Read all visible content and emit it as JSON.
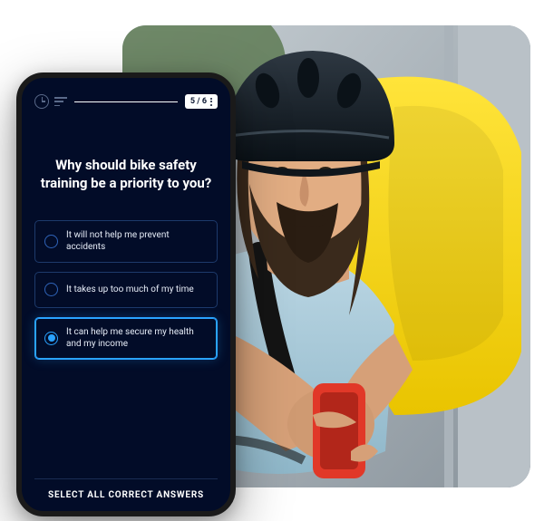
{
  "background": {
    "alt": "Bearded delivery cyclist wearing a black helmet and yellow backpack looking at a red smartphone"
  },
  "quiz": {
    "progress_counter": "5 / 6",
    "question": "Why should bike safety training be a priority to you?",
    "options": [
      {
        "label": "It will not help me prevent accidents",
        "selected": false
      },
      {
        "label": "It takes up too much of my time",
        "selected": false
      },
      {
        "label": "It can help me secure my health and my income",
        "selected": true
      }
    ],
    "footer_hint": "SELECT ALL CORRECT ANSWERS"
  }
}
